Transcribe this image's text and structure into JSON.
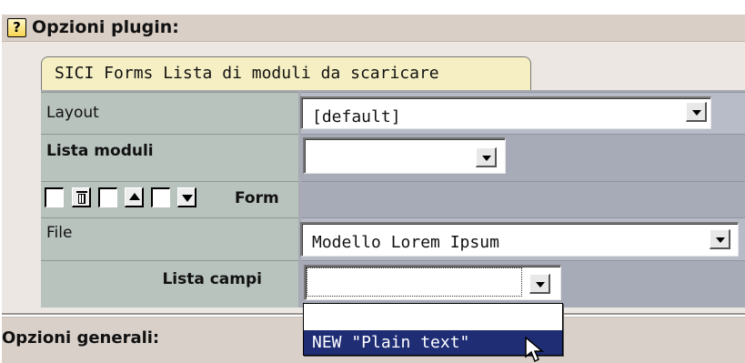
{
  "plugin": {
    "help_icon": "question-help-icon",
    "title": "Opzioni plugin:",
    "tab": "SICI Forms Lista di moduli da scaricare"
  },
  "fields": {
    "layout": {
      "label": "Layout",
      "value": "[default]"
    },
    "lista_moduli": {
      "label": "Lista moduli",
      "value": ""
    },
    "form_toolbar": {
      "label": "Form",
      "icons": [
        "delete-icon",
        "move-up-icon",
        "move-down-icon"
      ]
    },
    "file": {
      "label": "File",
      "value": "Modello Lorem Ipsum"
    },
    "lista_campi": {
      "label": "Lista campi",
      "value": "",
      "options": [
        "",
        "NEW \"Plain text\""
      ],
      "selected": "NEW \"Plain text\""
    }
  },
  "general": {
    "title": "Opzioni generali:"
  },
  "colors": {
    "header_bg": "#d9cfc7",
    "tab_bg": "#f5efc3",
    "label_bg": "#b8c3be",
    "value_bg": "#a7aab7",
    "selected_option": "#1f2d75"
  }
}
